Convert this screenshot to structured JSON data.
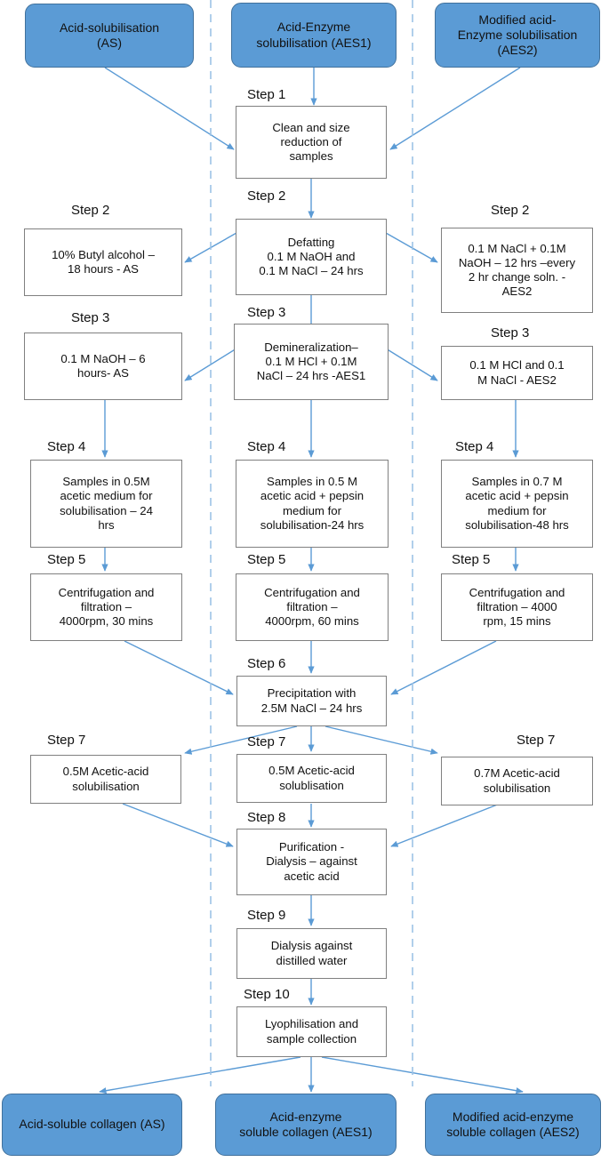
{
  "diagram": {
    "title_colors": {
      "terminal_fill": "#5B9BD5",
      "terminal_border": "#41719C",
      "process_border": "#808080",
      "arrow": "#5B9BD5",
      "divider": "#9DC3E6"
    },
    "lane_dividers": [
      237,
      464
    ]
  },
  "terminals_top": [
    {
      "label": "Acid-solubilisation\n(AS)"
    },
    {
      "label": "Acid-Enzyme\nsolubilisation (AES1)"
    },
    {
      "label": "Modified acid-\nEnzyme solubilisation\n(AES2)"
    }
  ],
  "terminals_bottom": [
    {
      "label": "Acid-soluble collagen (AS)"
    },
    {
      "label": "Acid-enzyme\nsoluble collagen (AES1)"
    },
    {
      "label": "Modified acid-enzyme\nsoluble collagen (AES2)"
    }
  ],
  "steps": {
    "left": [
      {
        "step": "Step 2",
        "text": "10% Butyl alcohol –\n18 hours - AS"
      },
      {
        "step": "Step 3",
        "text": "0.1 M NaOH – 6\nhours- AS"
      },
      {
        "step": "Step 4",
        "text": "Samples in 0.5M\nacetic medium for\nsolubilisation – 24\nhrs"
      },
      {
        "step": "Step 5",
        "text": "Centrifugation and\nfiltration –\n4000rpm, 30 mins"
      },
      {
        "step": "Step 7",
        "text": "0.5M Acetic-acid\nsolubilisation"
      }
    ],
    "middle": [
      {
        "step": "Step 1",
        "text": "Clean and size\nreduction of\nsamples"
      },
      {
        "step": "Step 2",
        "text": "Defatting\n0.1 M NaOH and\n0.1 M NaCl – 24 hrs"
      },
      {
        "step": "Step 3",
        "text": "Demineralization–\n0.1 M HCl + 0.1M\nNaCl – 24 hrs -AES1"
      },
      {
        "step": "Step 4",
        "text": "Samples in 0.5 M\nacetic acid + pepsin\nmedium for\nsolubilisation-24 hrs"
      },
      {
        "step": "Step 5",
        "text": "Centrifugation and\nfiltration –\n4000rpm, 60 mins"
      },
      {
        "step": "Step 6",
        "text": "Precipitation with\n2.5M NaCl – 24 hrs"
      },
      {
        "step": "Step 7",
        "text": "0.5M Acetic-acid\nsolublisation"
      },
      {
        "step": "Step 8",
        "text": "Purification -\nDialysis – against\nacetic acid"
      },
      {
        "step": "Step 9",
        "text": "Dialysis against\ndistilled water"
      },
      {
        "step": "Step 10",
        "text": "Lyophilisation and\nsample collection"
      }
    ],
    "right": [
      {
        "step": "Step 2",
        "text": "0.1 M NaCl + 0.1M\nNaOH – 12 hrs –every\n2 hr change soln. -\nAES2"
      },
      {
        "step": "Step 3",
        "text": "0.1 M HCl and 0.1\nM NaCl - AES2"
      },
      {
        "step": "Step 4",
        "text": "Samples in 0.7 M\nacetic acid + pepsin\nmedium for\nsolubilisation-48 hrs"
      },
      {
        "step": "Step 5",
        "text": "Centrifugation and\nfiltration – 4000\nrpm, 15 mins"
      },
      {
        "step": "Step 7",
        "text": "0.7M Acetic-acid\nsolubilisation"
      }
    ]
  }
}
